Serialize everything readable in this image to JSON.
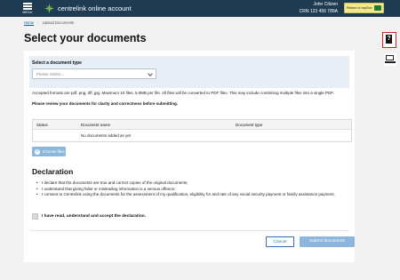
{
  "header": {
    "menu_label": "MENU",
    "brand": "centrelink online account",
    "user_name": "John Citizen",
    "crn": "CRN 123 456 789A",
    "return_button": "Return to myGov"
  },
  "breadcrumb": {
    "home": "Home",
    "current": "Upload Documents"
  },
  "page_title": "Select your documents",
  "document_type": {
    "label": "Select a document type",
    "selected": "Please Select..."
  },
  "info": {
    "formats": "Accepted formats are pdf, png, tiff, jpg. Maximum 10 files, 5.0MB per file. All files will be converted to PDF files. This may include combining multiple files into a single PDF.",
    "review": "Please review your documents for clarity and correctness before submitting."
  },
  "table": {
    "columns": [
      "Status",
      "Document name",
      "Document type"
    ],
    "empty_message": "No documents added as yet"
  },
  "choose_files_label": "Choose files",
  "declaration": {
    "title": "Declaration",
    "items": [
      "I declare that the documents are true and correct copies of the original documents;",
      "I understand that giving false or misleading information is a serious offence;",
      "I consent to Centrelink using the documents for the assessment of my qualification, eligibility for and rate of any social security payment or family assistance payment."
    ],
    "accept_label": "I have read, understand and accept the declaration."
  },
  "actions": {
    "cancel": "Cancel",
    "submit": "Submit documents"
  },
  "colors": {
    "header_bg": "#1f3b52",
    "primary": "#2f6fb0",
    "disabled_button": "#8db6dc",
    "help_border": "#d42020",
    "return_button_bg": "#f3e98a"
  }
}
